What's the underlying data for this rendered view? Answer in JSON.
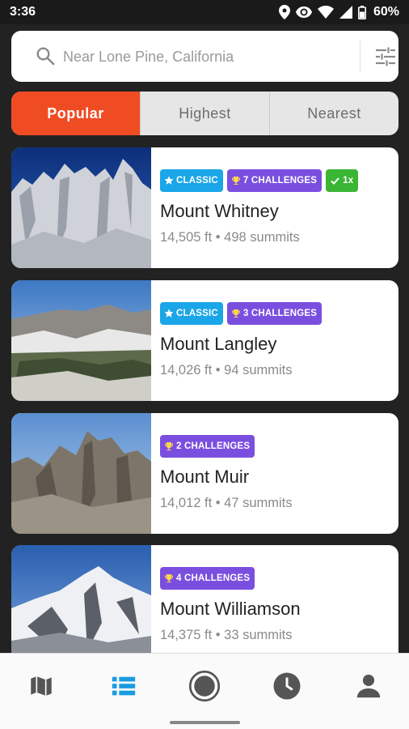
{
  "status_bar": {
    "time": "3:36",
    "battery": "60%",
    "icons": [
      "location-icon",
      "eye-icon",
      "wifi-icon",
      "signal-icon",
      "battery-icon"
    ]
  },
  "search": {
    "placeholder": "Near Lone Pine, California",
    "value": ""
  },
  "tabs": [
    {
      "label": "Popular",
      "active": true
    },
    {
      "label": "Highest",
      "active": false
    },
    {
      "label": "Nearest",
      "active": false
    }
  ],
  "peaks": [
    {
      "name": "Mount Whitney",
      "stats": "14,505 ft • 498 summits",
      "badges": [
        {
          "type": "classic",
          "icon": "star-icon",
          "label": "CLASSIC"
        },
        {
          "type": "challenge",
          "icon": "trophy-icon",
          "label": "7 CHALLENGES"
        },
        {
          "type": "done",
          "icon": "check-icon",
          "label": "1x"
        }
      ]
    },
    {
      "name": "Mount Langley",
      "stats": "14,026 ft • 94 summits",
      "badges": [
        {
          "type": "classic",
          "icon": "star-icon",
          "label": "CLASSIC"
        },
        {
          "type": "challenge",
          "icon": "trophy-icon",
          "label": "3 CHALLENGES"
        }
      ]
    },
    {
      "name": "Mount Muir",
      "stats": "14,012 ft • 47 summits",
      "badges": [
        {
          "type": "challenge",
          "icon": "trophy-icon",
          "label": "2 CHALLENGES"
        }
      ]
    },
    {
      "name": "Mount Williamson",
      "stats": "14,375 ft • 33 summits",
      "badges": [
        {
          "type": "challenge",
          "icon": "trophy-icon",
          "label": "4 CHALLENGES"
        }
      ]
    }
  ],
  "bottom_nav": [
    {
      "icon": "map-icon",
      "active": false
    },
    {
      "icon": "list-icon",
      "active": true
    },
    {
      "icon": "record-icon",
      "active": false
    },
    {
      "icon": "history-clock-icon",
      "active": false
    },
    {
      "icon": "profile-icon",
      "active": false
    }
  ],
  "colors": {
    "accent": "#f04c24",
    "classic_badge": "#1aa6e8",
    "challenge_badge": "#7a4fe0",
    "done_badge": "#3ab534",
    "nav_active": "#1a9be0"
  }
}
